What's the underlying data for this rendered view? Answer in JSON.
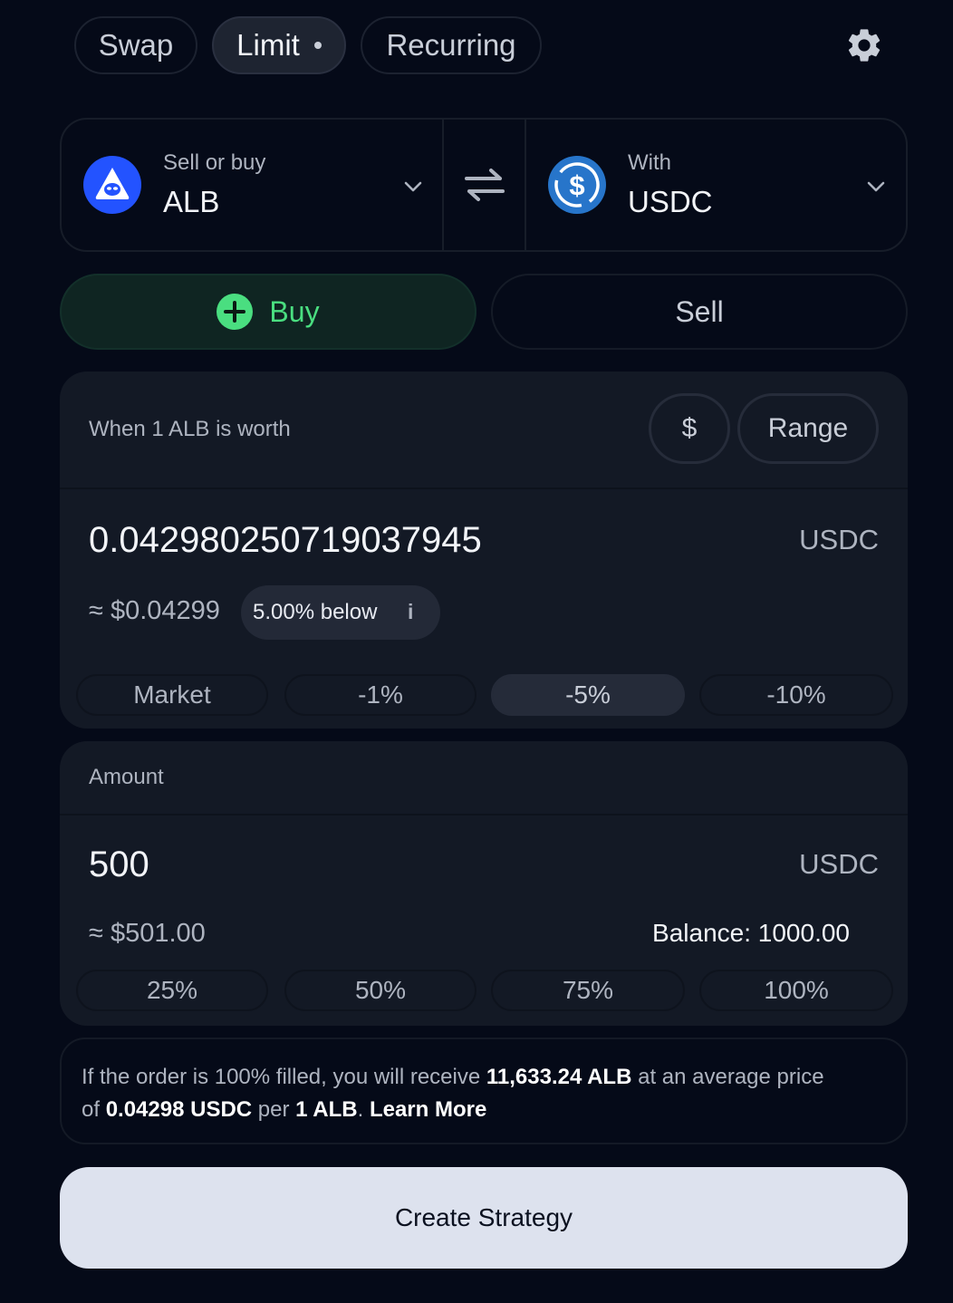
{
  "tabs": [
    {
      "label": "Swap"
    },
    {
      "label": "Limit"
    },
    {
      "label": "Recurring"
    }
  ],
  "pair": {
    "left_label": "Sell or buy",
    "left_token": "ALB",
    "right_label": "With",
    "right_token": "USDC"
  },
  "side": {
    "buy_label": "Buy",
    "sell_label": "Sell",
    "selected": "Buy"
  },
  "trigger": {
    "title": "When 1 ALB is worth",
    "dollar_label": "$",
    "range_label": "Range",
    "price_value": "0.042980250719037945",
    "price_unit": "USDC",
    "usd_equiv": "≈ $0.04299",
    "diff_badge": "5.00% below",
    "info_glyph": "i",
    "presets": [
      "Market",
      "-1%",
      "-5%",
      "-10%"
    ],
    "selected_preset": "-5%"
  },
  "amount": {
    "title": "Amount",
    "value": "500",
    "unit": "USDC",
    "usd_equiv": "≈ $501.00",
    "balance": "Balance: 1000.00",
    "presets": [
      "25%",
      "50%",
      "75%",
      "100%"
    ]
  },
  "summary": {
    "t1": "If the order is 100% filled, you will receive ",
    "receive": "11,633.24 ALB",
    "t2": " at an average price",
    "t3": "of ",
    "avg_price": "0.04298 USDC",
    "t4": " per ",
    "per_unit": "1 ALB",
    "t5": ". ",
    "learn_more": "Learn More"
  },
  "cta": {
    "label": "Create Strategy"
  },
  "colors": {
    "background": "#050a18",
    "card": "#131925",
    "buy_green": "#4ade80",
    "cta_bg": "#dde2ee",
    "usdc_blue": "#2775ca",
    "alb_blue": "#2353ff"
  },
  "icons": {
    "settings": "gear-icon",
    "swap": "swap-arrows-icon",
    "chevron": "chevron-down-icon",
    "plus": "plus-circle-icon",
    "info": "info-icon"
  }
}
